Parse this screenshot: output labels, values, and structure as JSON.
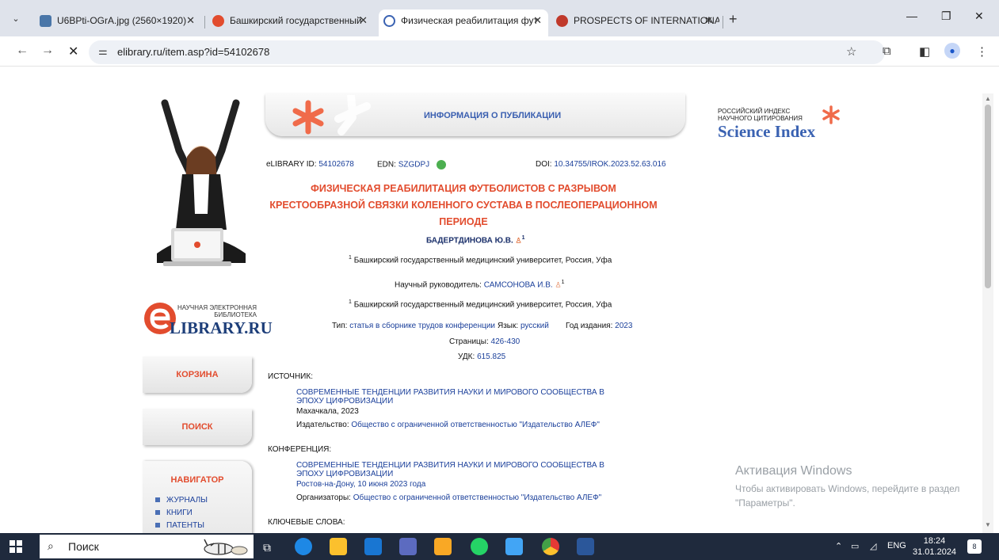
{
  "browser": {
    "tabs": [
      {
        "title": "U6BPti-OGrA.jpg (2560×1920)",
        "favicon_color": "#4a76a8"
      },
      {
        "title": "Башкирский государственный",
        "favicon_color": "#e24c2e"
      },
      {
        "title": "Физическая реабилитация фут",
        "favicon_color": "#3a62b2"
      },
      {
        "title": "PROSPECTS OF INTERNATIONA",
        "favicon_color": "#c0392b"
      }
    ],
    "url": "elibrary.ru/item.asp?id=54102678"
  },
  "left": {
    "logo_small": "НАУЧНАЯ ЭЛЕКТРОННАЯ БИБЛИОТЕКА",
    "logo_big": "LIBRARY.RU",
    "cart": "КОРЗИНА",
    "search": "ПОИСК",
    "navigator": "НАВИГАТОР",
    "nav_links": [
      "ЖУРНАЛЫ",
      "КНИГИ",
      "ПАТЕНТЫ"
    ]
  },
  "header": {
    "title": "ИНФОРМАЦИЯ О ПУБЛИКАЦИИ"
  },
  "science_index": {
    "small": "РОССИЙСКИЙ ИНДЕКС\nНАУЧНОГО ЦИТИРОВАНИЯ",
    "big": "Science Index"
  },
  "pub": {
    "elibrary_id_label": "eLIBRARY ID:",
    "elibrary_id": "54102678",
    "edn_label": "EDN:",
    "edn": "SZGDPJ",
    "doi_label": "DOI:",
    "doi": "10.34755/IROK.2023.52.63.016",
    "title": "ФИЗИЧЕСКАЯ РЕАБИЛИТАЦИЯ ФУТБОЛИСТОВ С РАЗРЫВОМ КРЕСТООБРАЗНОЙ СВЯЗКИ КОЛЕННОГО СУСТАВА В ПОСЛЕОПЕРАЦИОННОМ ПЕРИОДЕ",
    "author": "БАДЕРТДИНОВА Ю.В.",
    "affiliation": "Башкирский государственный медицинский университет, Россия, Уфа",
    "supervisor_label": "Научный руководитель:",
    "supervisor": "САМСОНОВА И.В.",
    "type_label": "Тип:",
    "type": "статья в сборнике трудов конференции",
    "lang_label": "Язык:",
    "lang": "русский",
    "year_label": "Год издания:",
    "year": "2023",
    "pages_label": "Страницы:",
    "pages": "426-430",
    "udk_label": "УДК:",
    "udk": "615.825"
  },
  "source": {
    "label": "ИСТОЧНИК:",
    "title": "СОВРЕМЕННЫЕ ТЕНДЕНЦИИ РАЗВИТИЯ НАУКИ И МИРОВОГО СООБЩЕСТВА В ЭПОХУ ЦИФРОВИЗАЦИИ",
    "place": "Махачкала, 2023",
    "publisher_label": "Издательство:",
    "publisher": "Общество с ограниченной ответственностью \"Издательство АЛЕФ\""
  },
  "conference": {
    "label": "КОНФЕРЕНЦИЯ:",
    "title": "СОВРЕМЕННЫЕ ТЕНДЕНЦИИ РАЗВИТИЯ НАУКИ И МИРОВОГО СООБЩЕСТВА В ЭПОХУ ЦИФРОВИЗАЦИИ",
    "place": "Ростов-на-Дону, 10 июня 2023 года",
    "organizers_label": "Организаторы:",
    "organizers": "Общество с ограниченной ответственностью \"Издательство АЛЕФ\""
  },
  "keywords_label": "КЛЮЧЕВЫЕ СЛОВА:",
  "watermark": {
    "title": "Активация Windows",
    "text": "Чтобы активировать Windows, перейдите в раздел \"Параметры\"."
  },
  "taskbar": {
    "search": "Поиск",
    "lang": "ENG",
    "time": "18:24",
    "date": "31.01.2024",
    "notifications": "8"
  },
  "colors": {
    "accent": "#e24c2e",
    "link": "#1a3f9a"
  }
}
